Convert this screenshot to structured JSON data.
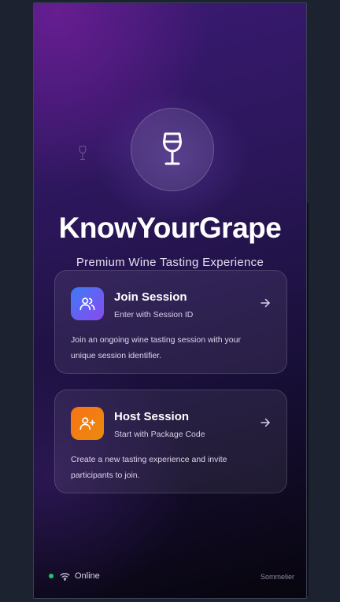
{
  "app": {
    "title": "KnowYourGrape",
    "subtitle": "Premium Wine Tasting Experience"
  },
  "icons": {
    "logo": "wine-glass-icon",
    "join": "users-icon",
    "host": "user-plus-icon",
    "arrow": "arrow-right-icon",
    "status": "wifi-icon"
  },
  "cards": {
    "join": {
      "title": "Join Session",
      "subtitle": "Enter with Session ID",
      "description": "Join an ongoing wine tasting session with your unique session identifier."
    },
    "host": {
      "title": "Host Session",
      "subtitle": "Start with Package Code",
      "description": "Create a new tasting experience and invite participants to join."
    }
  },
  "footer": {
    "status": "Online",
    "role": "Sommelier"
  },
  "colors": {
    "status_online": "#22c55e",
    "join_gradient": [
      "#3b7bf6",
      "#8b49f0"
    ],
    "host_gradient": [
      "#f97316",
      "#ea8a0c"
    ]
  }
}
